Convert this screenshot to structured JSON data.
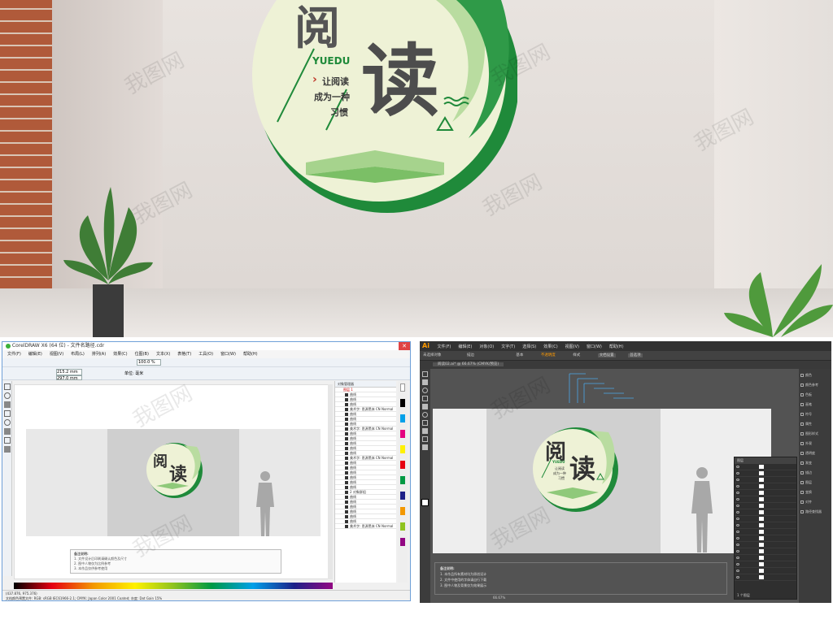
{
  "scene": {
    "panel": {
      "title_big": "阅",
      "title_big2": "读",
      "pinyin": "YUEDU",
      "slogan": [
        "让阅读",
        "成为一种",
        "习惯"
      ],
      "arrow": "›"
    },
    "watermark": "我图网"
  },
  "coreldraw": {
    "title": "CorelDRAW X6 (64 位) - 文件名路径.cdr",
    "menu": [
      "文件(F)",
      "编辑(E)",
      "视图(V)",
      "布局(L)",
      "排列(A)",
      "效果(C)",
      "位图(B)",
      "文本(X)",
      "表格(T)",
      "工具(O)",
      "窗口(W)",
      "帮助(H)"
    ],
    "fields": [
      "215.2 mm",
      "297.0 mm",
      "100.0 %"
    ],
    "unit_label": "单位: 毫米",
    "obj_manager_title": "对象管理器",
    "layer_root": "图层 1",
    "layer_items": [
      "曲线",
      "曲线",
      "曲线",
      "美术字: 思源黑体 CN Normal",
      "曲线",
      "曲线",
      "曲线",
      "美术字: 思源黑体 CN Normal",
      "曲线",
      "曲线",
      "曲线",
      "曲线",
      "曲线",
      "美术字: 思源黑体 CN Normal",
      "曲线",
      "曲线",
      "曲线",
      "曲线",
      "曲线",
      "曲线",
      "2 对象群组",
      "曲线",
      "曲线",
      "曲线",
      "曲线",
      "曲线",
      "曲线",
      "美术字: 思源黑体 CN Normal"
    ],
    "notes_title": "备注说明:",
    "notes_lines": [
      "1. 文件设计后印刷请确认颜色及尺寸",
      "2. 图中人物仅为比例参考",
      "3. 本作品仅供参考使用"
    ],
    "status": "(437.876, 975.376)",
    "status2": "文档颜色预置文件: RGB: sRGB IEC61966-2.1; CMYK: Japan Color 2001 Coated; 灰度: Dot Gain 15%",
    "art": {
      "c1": "阅",
      "c2": "读"
    }
  },
  "illustrator": {
    "logo": "Ai",
    "menu": [
      "文件(F)",
      "编辑(E)",
      "对象(O)",
      "文字(T)",
      "选择(S)",
      "效果(C)",
      "视图(V)",
      "窗口(W)",
      "帮助(H)"
    ],
    "tab": "阅读02.ai* @ 66.67% (CMYK/预览)",
    "toolbar_items": [
      "未选择对象",
      "描边",
      "基本",
      "不透明度",
      "样式",
      "文档设置",
      "首选项"
    ],
    "right_panel": [
      "颜色",
      "颜色参考",
      "色板",
      "画笔",
      "符号",
      "属性",
      "图形样式",
      "外观",
      "透明度",
      "渐变",
      "描边",
      "图层",
      "变换",
      "对齐",
      "路径查找器"
    ],
    "layers_tab": "图层",
    "layers_footer": "1 个图层",
    "notes_title": "备注说明:",
    "notes_lines": [
      "1. 本作品所有素材均为原创设计",
      "2. 文件中使用的字体请自行下载",
      "3. 图中人物及背景仅为效果展示"
    ],
    "zoom": "66.67%",
    "art": {
      "c1": "阅",
      "c2": "读",
      "pinyin": "YUEDU",
      "slogan": [
        "让阅读",
        "成为一种",
        "习惯"
      ]
    }
  }
}
